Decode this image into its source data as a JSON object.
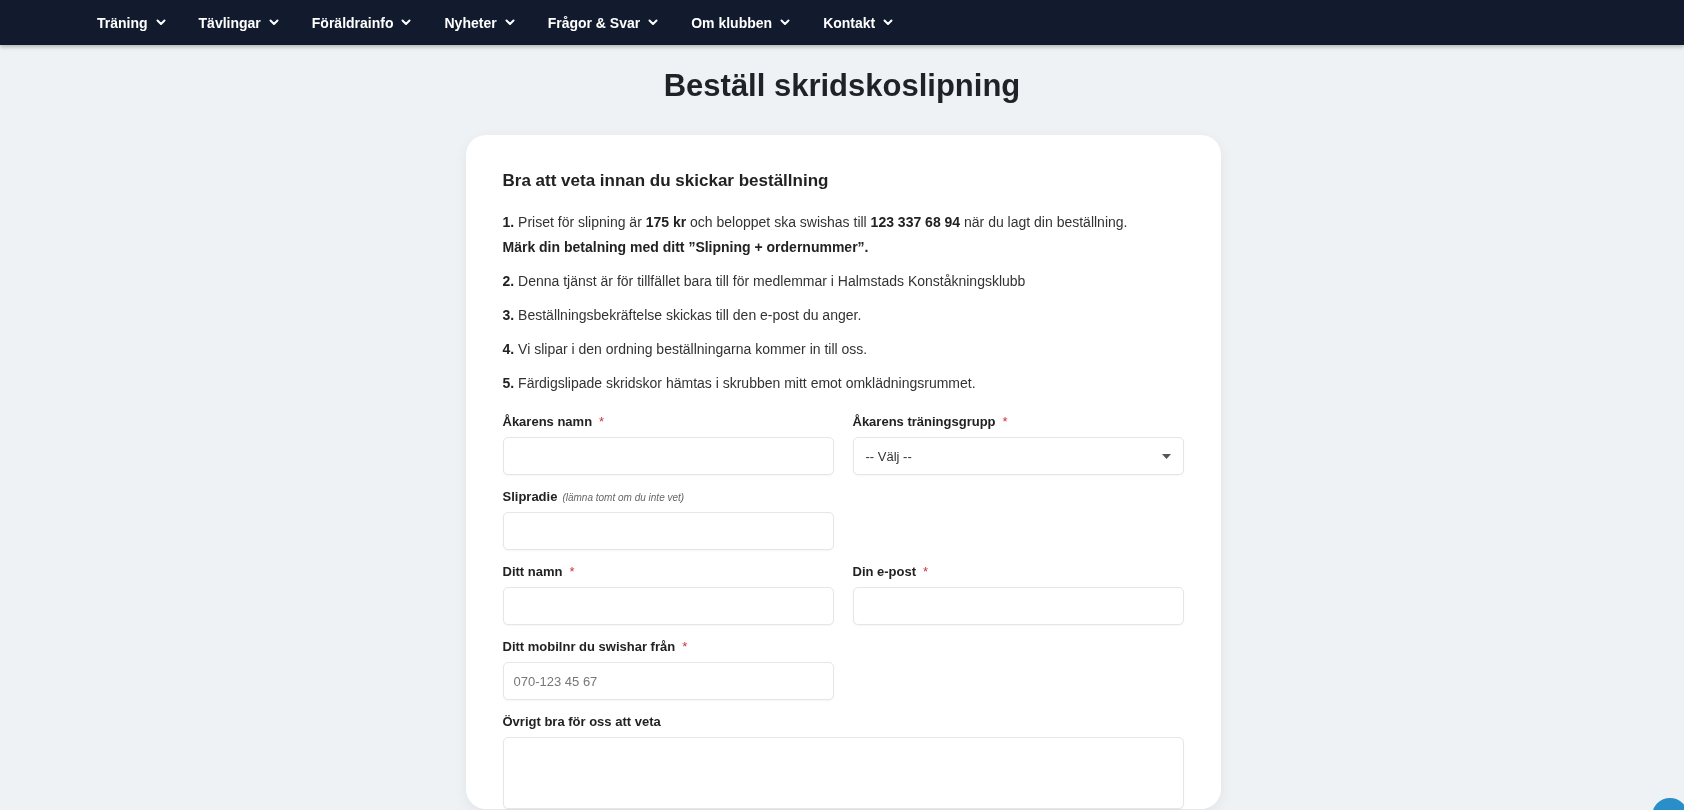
{
  "nav": {
    "items": [
      {
        "label": "Träning"
      },
      {
        "label": "Tävlingar"
      },
      {
        "label": "Föräldrainfo"
      },
      {
        "label": "Nyheter"
      },
      {
        "label": "Frågor & Svar"
      },
      {
        "label": "Om klubben"
      },
      {
        "label": "Kontakt"
      }
    ]
  },
  "title": "Beställ skridskoslipning",
  "notice": {
    "heading": "Bra att veta innan du skickar beställning",
    "items": [
      {
        "text": "**1.** Priset för slipning är **175 kr** och beloppet ska swishas till **123 337 68 94** när du lagt din beställning.",
        "note": "Märk din betalning med ditt ”Slipning + ordernummer”."
      },
      {
        "text": "**2.** Denna tjänst är för tillfället bara till för medlemmar i Halmstads Konståkningsklubb"
      },
      {
        "text": "**3.** Beställningsbekräftelse skickas till den e-post du anger."
      },
      {
        "text": "**4.** Vi slipar i den ordning beställningarna kommer in till oss."
      },
      {
        "text": "**5.** Färdigslipade skridskor hämtas i skrubben mitt emot omklädningsrummet."
      }
    ]
  },
  "form": {
    "required_mark": "*",
    "rows": [
      {
        "fields": [
          {
            "kind": "text",
            "label": "Åkarens namn",
            "required": true
          },
          {
            "kind": "select",
            "label": "Åkarens träningsgrupp",
            "required": true,
            "value": "-- Välj --"
          }
        ]
      },
      {
        "fields": [
          {
            "kind": "text",
            "label": "Slipradie",
            "hint": "(lämna tomt om du inte vet)"
          }
        ]
      },
      {
        "fields": [
          {
            "kind": "text",
            "label": "Ditt namn",
            "required": true
          },
          {
            "kind": "text",
            "label": "Din e-post",
            "required": true
          }
        ]
      },
      {
        "fields": [
          {
            "kind": "text",
            "label": "Ditt mobilnr du swishar från",
            "required": true,
            "placeholder": "070-123 45 67"
          }
        ]
      },
      {
        "fields": [
          {
            "kind": "textarea",
            "label": "Övrigt bra för oss att veta"
          }
        ]
      }
    ]
  }
}
